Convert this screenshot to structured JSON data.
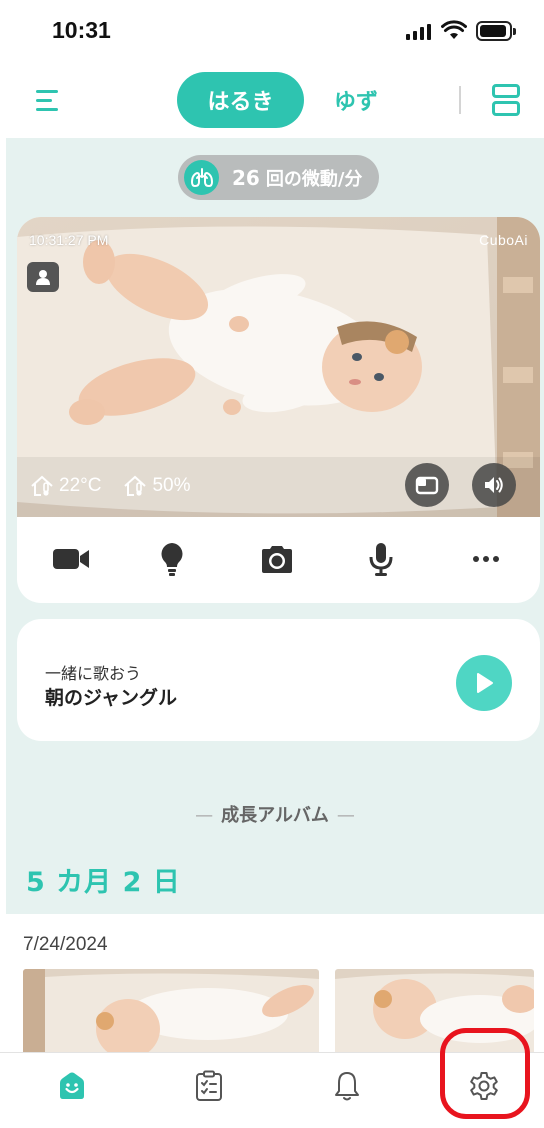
{
  "status_bar": {
    "time": "10:31"
  },
  "header": {
    "tabs": [
      {
        "label": "はるき",
        "active": true
      },
      {
        "label": "ゆず",
        "active": false
      }
    ],
    "icons": {
      "menu": "menu-icon",
      "layout": "layout-toggle-icon"
    }
  },
  "breathing": {
    "count": "26",
    "unit": "回の微動/分"
  },
  "camera": {
    "timestamp": "10:31:27 PM",
    "brand": "CuboAi",
    "temperature": "22°C",
    "humidity": "50%",
    "toolbar": [
      "video-camera-icon",
      "light-bulb-icon",
      "camera-icon",
      "microphone-icon",
      "more-icon"
    ]
  },
  "song": {
    "subtitle": "一緒に歌おう",
    "title": "朝のジャングル"
  },
  "album": {
    "heading": "成長アルバム",
    "age": "5 カ月 2 日",
    "date": "7/24/2024"
  },
  "bottom_nav": {
    "items": [
      "home-icon",
      "log-icon",
      "notifications-icon",
      "settings-icon"
    ]
  },
  "colors": {
    "accent": "#2ec4b0",
    "background": "#e6f2f0",
    "highlight": "#e8141e"
  }
}
